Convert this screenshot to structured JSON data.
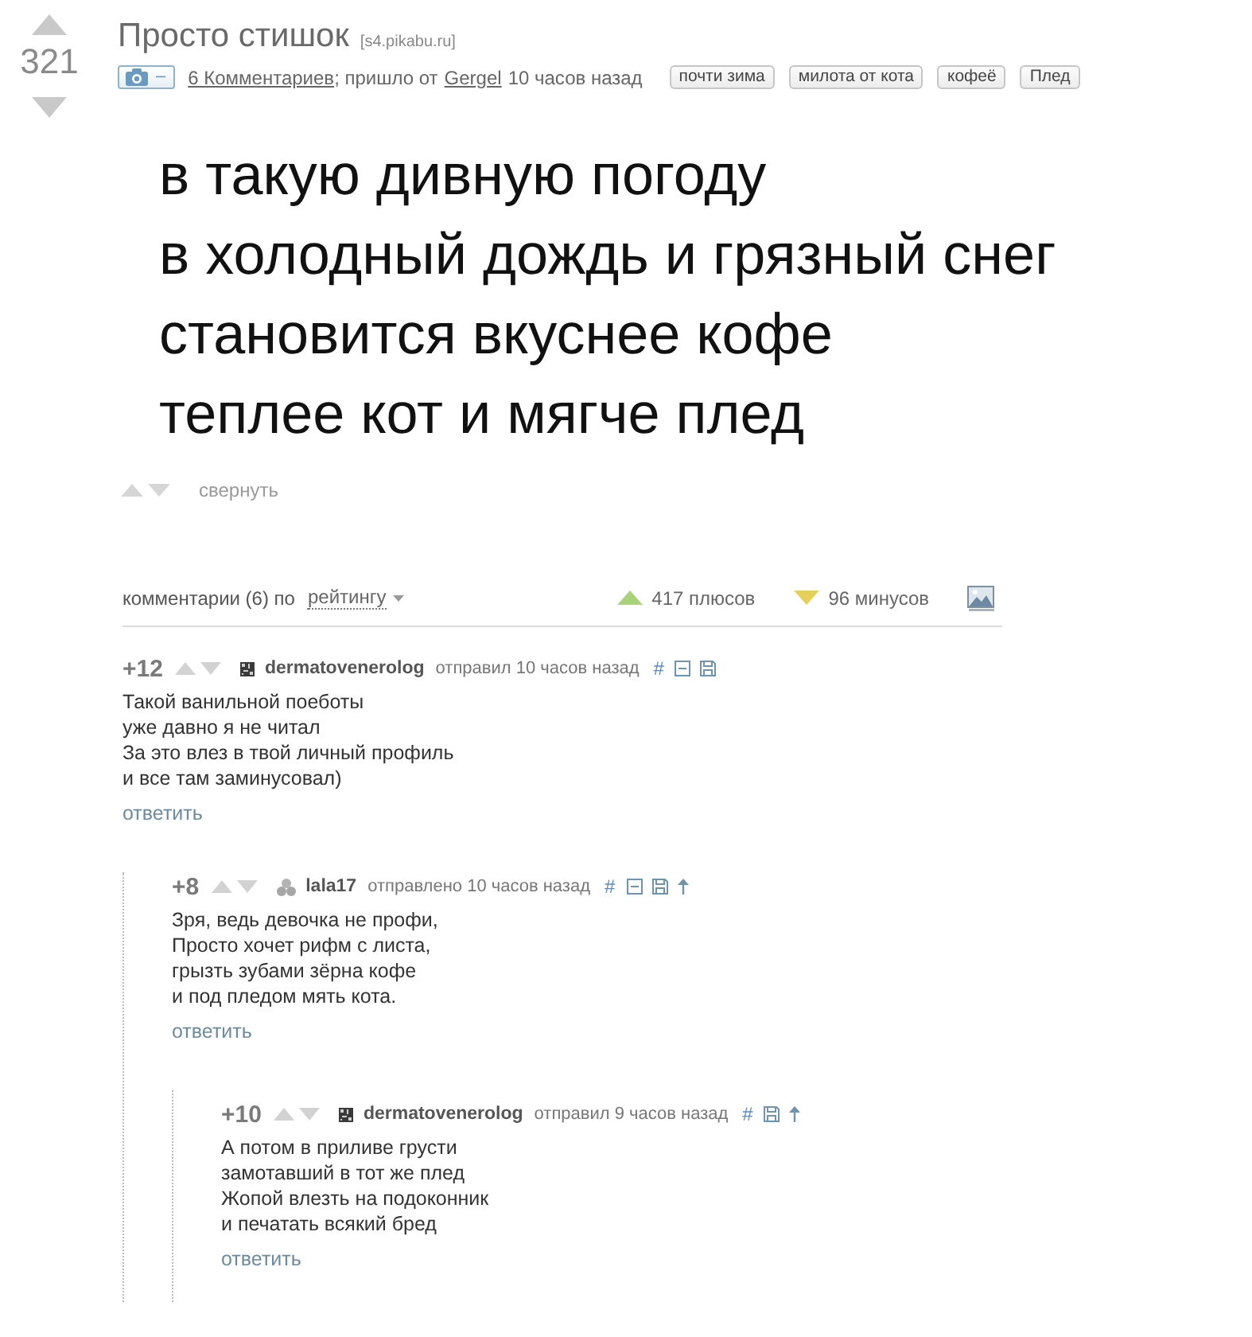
{
  "post": {
    "rating": "321",
    "title": "Просто стишок",
    "source": "[s4.pikabu.ru]",
    "camera_button": "–",
    "comments_link": "6 Комментариев",
    "via_text": "; пришло от",
    "author": "Gergel",
    "time": "10 часов назад",
    "tags": [
      "почти зима",
      "милота от кота",
      "кофеё",
      "Плед"
    ]
  },
  "poem": [
    "в такую дивную погоду",
    "в холодный дождь и грязный снег",
    "становится вкуснее кофе",
    "теплее кот и мягче плед"
  ],
  "post_actions": {
    "collapse": "свернуть"
  },
  "comments_header": {
    "label": "комментарии (6) по",
    "sort": "рейтингу",
    "pluses": "417 плюсов",
    "minuses": "96 минусов"
  },
  "comments": [
    {
      "score": "+12",
      "avatar": {
        "kind": "pattern"
      },
      "author": "dermatovenerolog",
      "posted": "отправил 10 часов назад",
      "anchor": "#",
      "collapse": true,
      "parent_link": false,
      "text": [
        "Такой ванильной поеботы",
        "уже давно я не читал",
        "За это влез в твой личный профиль",
        "и все там заминусовал)"
      ],
      "reply": "ответить",
      "children": [
        {
          "score": "+8",
          "avatar": {
            "kind": "default"
          },
          "author": "lala17",
          "posted": "отправлено 10 часов назад",
          "anchor": "#",
          "collapse": true,
          "parent_link": true,
          "text": [
            "Зря, ведь девочка не профи,",
            "Просто хочет рифм с листа,",
            "грызть зубами зёрна кофе",
            "и под пледом мять кота."
          ],
          "reply": "ответить",
          "children": [
            {
              "score": "+10",
              "avatar": {
                "kind": "pattern"
              },
              "author": "dermatovenerolog",
              "posted": "отправил 9 часов назад",
              "anchor": "#",
              "collapse": false,
              "parent_link": true,
              "text": [
                "А потом в приливе грусти",
                "замотавший в тот же плед",
                "Жопой влезть на подоконник",
                "и печатать всякий бред"
              ],
              "reply": "ответить"
            }
          ]
        }
      ]
    }
  ]
}
